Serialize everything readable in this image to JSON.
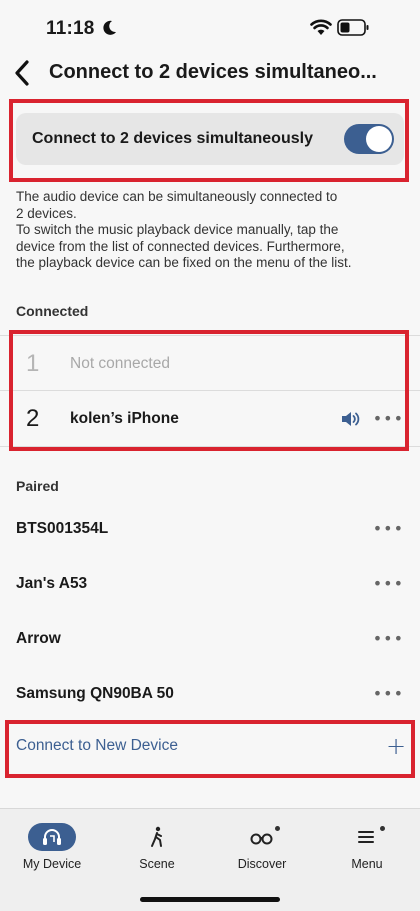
{
  "status_bar": {
    "time": "11:18"
  },
  "header": {
    "title": "Connect to 2 devices simultaneo..."
  },
  "toggle_section": {
    "label": "Connect to 2 devices simultaneously",
    "enabled": true
  },
  "description": {
    "line1": "The audio device can be simultaneously connected to",
    "line2": "2 devices.",
    "line3": "To switch the music playback device manually, tap the",
    "line4": "device from the list of connected devices. Furthermore,",
    "line5": "the playback device can be fixed on the menu of the list."
  },
  "connected": {
    "heading": "Connected",
    "items": [
      {
        "number": "1",
        "name": "Not connected"
      },
      {
        "number": "2",
        "name": "kolen’s iPhone"
      }
    ]
  },
  "paired": {
    "heading": "Paired",
    "items": [
      {
        "name": "BTS001354L"
      },
      {
        "name": "Jan's A53"
      },
      {
        "name": "Arrow"
      },
      {
        "name": "Samsung QN90BA 50"
      }
    ]
  },
  "connect_new": {
    "label": "Connect to New Device"
  },
  "tabs": [
    {
      "label": "My Device",
      "icon": "headphones-icon",
      "active": true
    },
    {
      "label": "Scene",
      "icon": "walking-person-icon"
    },
    {
      "label": "Discover",
      "icon": "binoculars-icon"
    },
    {
      "label": "Menu",
      "icon": "hamburger-menu-icon"
    }
  ],
  "colors": {
    "accent": "#3c5f91",
    "highlight": "#d9232f",
    "background": "#f7f7f7"
  }
}
